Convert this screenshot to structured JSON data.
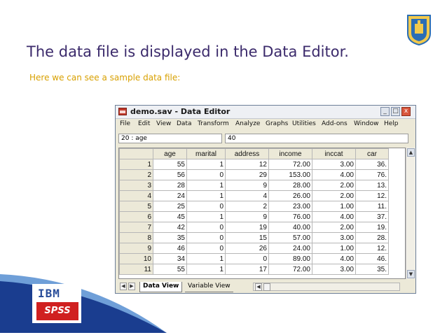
{
  "slide": {
    "title": "The data file is displayed in the Data Editor.",
    "subtitle": "Here we can see a sample data file:"
  },
  "window": {
    "title": "demo.sav - Data Editor",
    "buttons": {
      "minimize": "_",
      "maximize": "□",
      "close": "x"
    },
    "menu": [
      "File",
      "Edit",
      "View",
      "Data",
      "Transform",
      "Analyze",
      "Graphs",
      "Utilities",
      "Add-ons",
      "Window",
      "Help"
    ],
    "cell_ref": "20 : age",
    "cell_value": "40",
    "columns": [
      "age",
      "marital",
      "address",
      "income",
      "inccat",
      "car"
    ],
    "rows": [
      {
        "n": "1",
        "cells": [
          "55",
          "1",
          "12",
          "72.00",
          "3.00",
          "36."
        ]
      },
      {
        "n": "2",
        "cells": [
          "56",
          "0",
          "29",
          "153.00",
          "4.00",
          "76."
        ]
      },
      {
        "n": "3",
        "cells": [
          "28",
          "1",
          "9",
          "28.00",
          "2.00",
          "13."
        ]
      },
      {
        "n": "4",
        "cells": [
          "24",
          "1",
          "4",
          "26.00",
          "2.00",
          "12."
        ]
      },
      {
        "n": "5",
        "cells": [
          "25",
          "0",
          "2",
          "23.00",
          "1.00",
          "11."
        ]
      },
      {
        "n": "6",
        "cells": [
          "45",
          "1",
          "9",
          "76.00",
          "4.00",
          "37."
        ]
      },
      {
        "n": "7",
        "cells": [
          "42",
          "0",
          "19",
          "40.00",
          "2.00",
          "19."
        ]
      },
      {
        "n": "8",
        "cells": [
          "35",
          "0",
          "15",
          "57.00",
          "3.00",
          "28."
        ]
      },
      {
        "n": "9",
        "cells": [
          "46",
          "0",
          "26",
          "24.00",
          "1.00",
          "12."
        ]
      },
      {
        "n": "10",
        "cells": [
          "34",
          "1",
          "0",
          "89.00",
          "4.00",
          "46."
        ]
      },
      {
        "n": "11",
        "cells": [
          "55",
          "1",
          "17",
          "72.00",
          "3.00",
          "35."
        ]
      }
    ],
    "tabs": {
      "data_view": "Data View",
      "variable_view": "Variable View"
    }
  },
  "logo": {
    "ibm": "IBM",
    "spss": "SPSS"
  },
  "colors": {
    "title": "#3b2a6b",
    "subtitle": "#d8a000",
    "accent_blue": "#1a3d8f",
    "spss_red": "#d02020"
  }
}
